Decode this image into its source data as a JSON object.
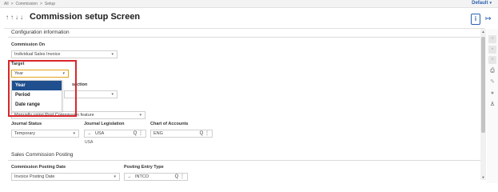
{
  "breadcrumb": {
    "items": [
      "All",
      "Commission",
      "Setup"
    ]
  },
  "top_right_menu": {
    "label": "Default",
    "caret": "▾"
  },
  "header": {
    "nav_icons": [
      "↑",
      "↑",
      "↓",
      "↓"
    ],
    "title": "Commission setup Screen",
    "info_label": "i",
    "exit_icon": "↦"
  },
  "configuration": {
    "section_title": "Configuration information",
    "commission_on": {
      "label": "Commission On",
      "value": "Individual Sales Invoice"
    },
    "target": {
      "label": "Target",
      "value": "Year"
    },
    "hidden_label_suffix": "saction",
    "method_value": "Manually using Post Commission feature",
    "journal_status": {
      "label": "Journal Status",
      "value": "Temporary"
    },
    "journal_legislation": {
      "label": "Journal Legislation",
      "arrow": "→",
      "value": "USA",
      "sub": "USA"
    },
    "chart_of_accounts": {
      "label": "Chart of Accounts",
      "value": "ENG"
    }
  },
  "target_dropdown": {
    "options": [
      "Year",
      "Period",
      "Date range"
    ],
    "selected": "Year"
  },
  "posting": {
    "section_title": "Sales Commission Posting",
    "commission_posting_date": {
      "label": "Commission Posting Date",
      "value": "Invoice Posting Date"
    },
    "posting_entry_type": {
      "label": "Posting Entry Type",
      "arrow": "→",
      "value": "INTCO"
    }
  },
  "glyphs": {
    "dropdown_caret": "▾",
    "lookup_actions": "Q ⋮",
    "scroll_up": "▲",
    "scroll_down": "▼"
  },
  "colors": {
    "accent": "#2a5fb0",
    "selected_option_bg": "#1f4f8f",
    "annotation_border": "#d9262b",
    "focus_border": "#e3a21a"
  }
}
